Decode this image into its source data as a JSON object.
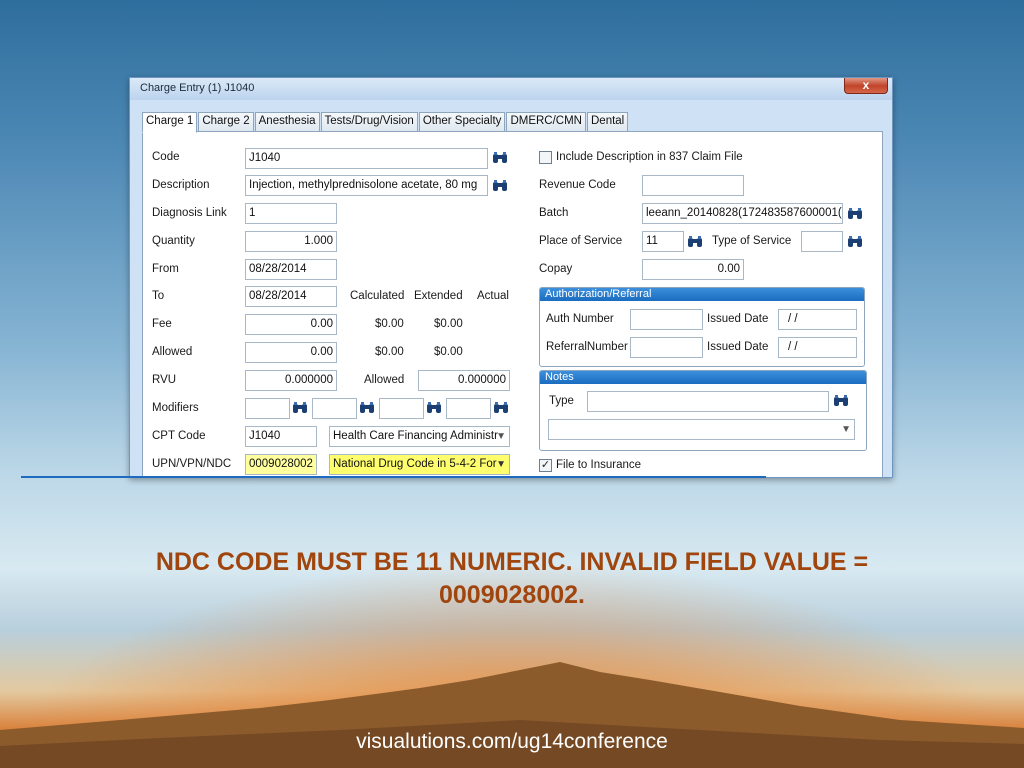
{
  "window": {
    "title": "Charge Entry (1) J1040",
    "close_symbol": "x"
  },
  "tabs": [
    "Charge 1",
    "Charge 2",
    "Anesthesia",
    "Tests/Drug/Vision",
    "Other Specialty",
    "DMERC/CMN",
    "Dental"
  ],
  "left": {
    "code_label": "Code",
    "code_value": "J1040",
    "description_label": "Description",
    "description_value": "Injection, methylprednisolone acetate, 80 mg",
    "diagnosis_link_label": "Diagnosis Link",
    "diagnosis_link_value": "1",
    "quantity_label": "Quantity",
    "quantity_value": "1.000",
    "from_label": "From",
    "from_value": "08/28/2014",
    "to_label": "To",
    "to_value": "08/28/2014",
    "calculated_header": "Calculated",
    "extended_header": "Extended",
    "actual_header": "Actual",
    "fee_label": "Fee",
    "fee_value": "0.00",
    "fee_calculated": "$0.00",
    "fee_extended": "$0.00",
    "allowed_label": "Allowed",
    "allowed_value": "0.00",
    "allowed_calculated": "$0.00",
    "allowed_extended": "$0.00",
    "rvu_label": "RVU",
    "rvu_value": "0.000000",
    "rvu_allowed_label": "Allowed",
    "rvu_allowed_value": "0.000000",
    "modifiers_label": "Modifiers",
    "cpt_label": "CPT Code",
    "cpt_value": "J1040",
    "cpt_source": "Health Care Financing Administr",
    "ndc_label": "UPN/VPN/NDC",
    "ndc_value": "0009028002",
    "ndc_format": "National Drug Code in 5-4-2 For"
  },
  "right": {
    "include_desc_label": "Include Description in 837 Claim File",
    "revenue_code_label": "Revenue Code",
    "revenue_code_value": "",
    "batch_label": "Batch",
    "batch_value": "leeann_20140828(172483587600001(",
    "pos_label": "Place of Service",
    "pos_value": "11",
    "tos_label": "Type of Service",
    "tos_value": "",
    "copay_label": "Copay",
    "copay_value": "0.00",
    "auth_group_title": "Authorization/Referral",
    "auth_number_label": "Auth Number",
    "auth_number_value": "",
    "issued_date_label": "Issued Date",
    "issued_date_value": "/ /",
    "referral_number_label": "ReferralNumber",
    "referral_number_value": "",
    "issued_date2_label": "Issued Date",
    "issued_date2_value": "/ /",
    "notes_group_title": "Notes",
    "notes_type_label": "Type",
    "notes_type_value": "",
    "file_to_insurance_label": "File to Insurance"
  },
  "slide": {
    "message": "NDC CODE MUST BE 11 NUMERIC.  INVALID FIELD VALUE = 0009028002.",
    "url": "visualutions.com/ug14conference"
  },
  "icons": {
    "lookup": "binoculars-icon",
    "dropdown": "chevron-down-icon",
    "check": "checkmark"
  },
  "colors": {
    "highlight": "#ffff9e",
    "message": "#a0450d",
    "group_header": "#1a6cbf"
  }
}
